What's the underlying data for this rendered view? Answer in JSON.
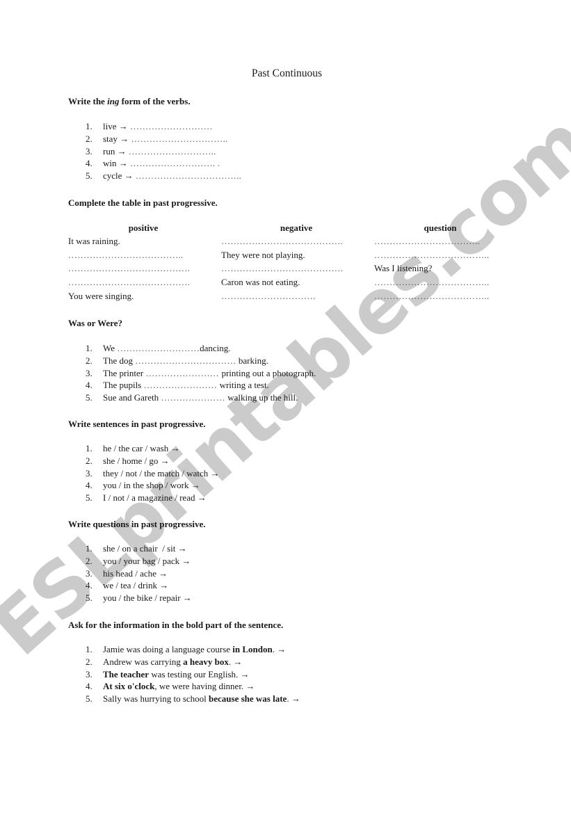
{
  "watermark": "ESLprintables.com",
  "title": "Past Continuous",
  "section1": {
    "heading_pre": "Write the ",
    "heading_em": "ing",
    "heading_post": " form of the verbs.",
    "items": [
      {
        "num": "1.",
        "text": "live → ",
        "blank": "………………………"
      },
      {
        "num": "2.",
        "text": "stay → ",
        "blank": "………………………….."
      },
      {
        "num": "3.",
        "text": "run → ",
        "blank": "……………………….."
      },
      {
        "num": "4.",
        "text": "win → ",
        "blank": "………………………. ."
      },
      {
        "num": "5.",
        "text": "cycle → ",
        "blank": "…………………………….."
      }
    ]
  },
  "section2": {
    "heading": "Complete the table in past progressive.",
    "columns": [
      "positive",
      "negative",
      "question"
    ],
    "rows": [
      [
        "It was raining.",
        "………………………………….",
        "…………………………….."
      ],
      [
        "………………………………..",
        "They were not playing.",
        "……………………………….."
      ],
      [
        "………………………………….",
        "………………………………….",
        "Was I listening?"
      ],
      [
        "………………………………….",
        "Caron was not eating.",
        "……………………………….."
      ],
      [
        "You were singing.",
        "………………………….",
        "……………………………….."
      ]
    ]
  },
  "section3": {
    "heading": "Was or Were?",
    "items": [
      {
        "num": "1.",
        "pre": "We ",
        "blank": "………………………",
        "post": "dancing."
      },
      {
        "num": "2.",
        "pre": "The dog ",
        "blank": "…………………………… ",
        "post": "barking."
      },
      {
        "num": "3.",
        "pre": "The printer ",
        "blank": "…………………… ",
        "post": "printing out a photograph."
      },
      {
        "num": "4.",
        "pre": "The pupils ",
        "blank": "…………………… ",
        "post": "writing a test."
      },
      {
        "num": "5.",
        "pre": "Sue and Gareth ",
        "blank": "………………… ",
        "post": "walking up the hill."
      }
    ]
  },
  "section4": {
    "heading": "Write sentences in past progressive.",
    "items": [
      {
        "num": "1.",
        "text": "he / the car / wash →"
      },
      {
        "num": "2.",
        "text": "she / home / go →"
      },
      {
        "num": "3.",
        "text": "they / not / the match / watch →"
      },
      {
        "num": "4.",
        "text": "you / in the shop / work →"
      },
      {
        "num": "5.",
        "text": "I / not / a magazine / read →"
      }
    ]
  },
  "section5": {
    "heading": "Write questions in past progressive.",
    "items": [
      {
        "num": "1.",
        "text": "she / on a chair  / sit →"
      },
      {
        "num": "2.",
        "text": "you / your bag / pack →"
      },
      {
        "num": "3.",
        "text": "his head / ache →"
      },
      {
        "num": "4.",
        "text": "we / tea / drink →"
      },
      {
        "num": "5.",
        "text": "you / the bike / repair →"
      }
    ]
  },
  "section6": {
    "heading": "Ask for the information in the bold part of the sentence.",
    "items": [
      {
        "num": "1.",
        "pre": "Jamie was doing a language course ",
        "bold": "in London",
        "post": ". →"
      },
      {
        "num": "2.",
        "pre": "Andrew was carrying ",
        "bold": "a heavy box",
        "post": ". →"
      },
      {
        "num": "3.",
        "pre": "",
        "bold": "The teacher",
        "post": " was testing our English. →"
      },
      {
        "num": "4.",
        "pre": "",
        "bold": "At six o'clock",
        "post": ", we were having dinner. →"
      },
      {
        "num": "5.",
        "pre": "Sally was hurrying to school ",
        "bold": "because she was late",
        "post": ". →"
      }
    ]
  }
}
